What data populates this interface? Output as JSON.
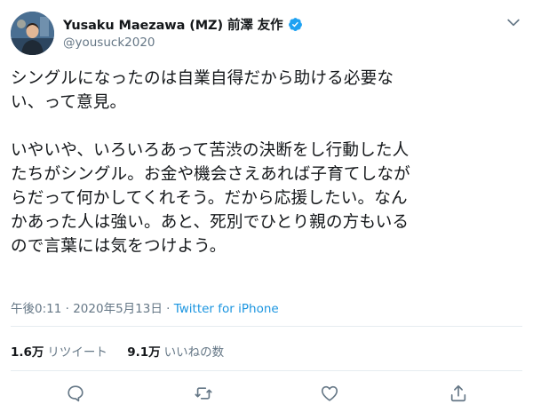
{
  "author": {
    "display_name": "Yusaku Maezawa (MZ) 前澤 友作",
    "handle": "@yousuck2020",
    "verified": true
  },
  "tweet": {
    "lines": [
      "シングルになったのは自業自得だから助ける必要な",
      "い、って意見。",
      "",
      "いやいや、いろいろあって苦渋の決断をし行動した人",
      "たちがシングル。お金や機会さえあれば子育てしなが",
      "らだって何かしてくれそう。だから応援したい。なん",
      "かあった人は強い。あと、死別でひとり親の方もいる",
      "ので言葉には気をつけよう。"
    ]
  },
  "meta": {
    "time": "午後0:11",
    "separator1": "·",
    "date": "2020年5月13日",
    "separator2": "·",
    "source": "Twitter for iPhone"
  },
  "stats": {
    "retweets_count": "1.6万",
    "retweets_label": "リツイート",
    "likes_count": "9.1万",
    "likes_label": "いいねの数"
  },
  "icons": {
    "chevron": "chevron-down-icon",
    "reply": "reply-icon",
    "retweet": "retweet-icon",
    "like": "heart-icon",
    "share": "share-icon",
    "verified": "verified-badge-icon"
  },
  "colors": {
    "accent": "#1da1f2",
    "link": "#1b95e0",
    "secondary_text": "#657786",
    "icon_gray": "#657786"
  }
}
